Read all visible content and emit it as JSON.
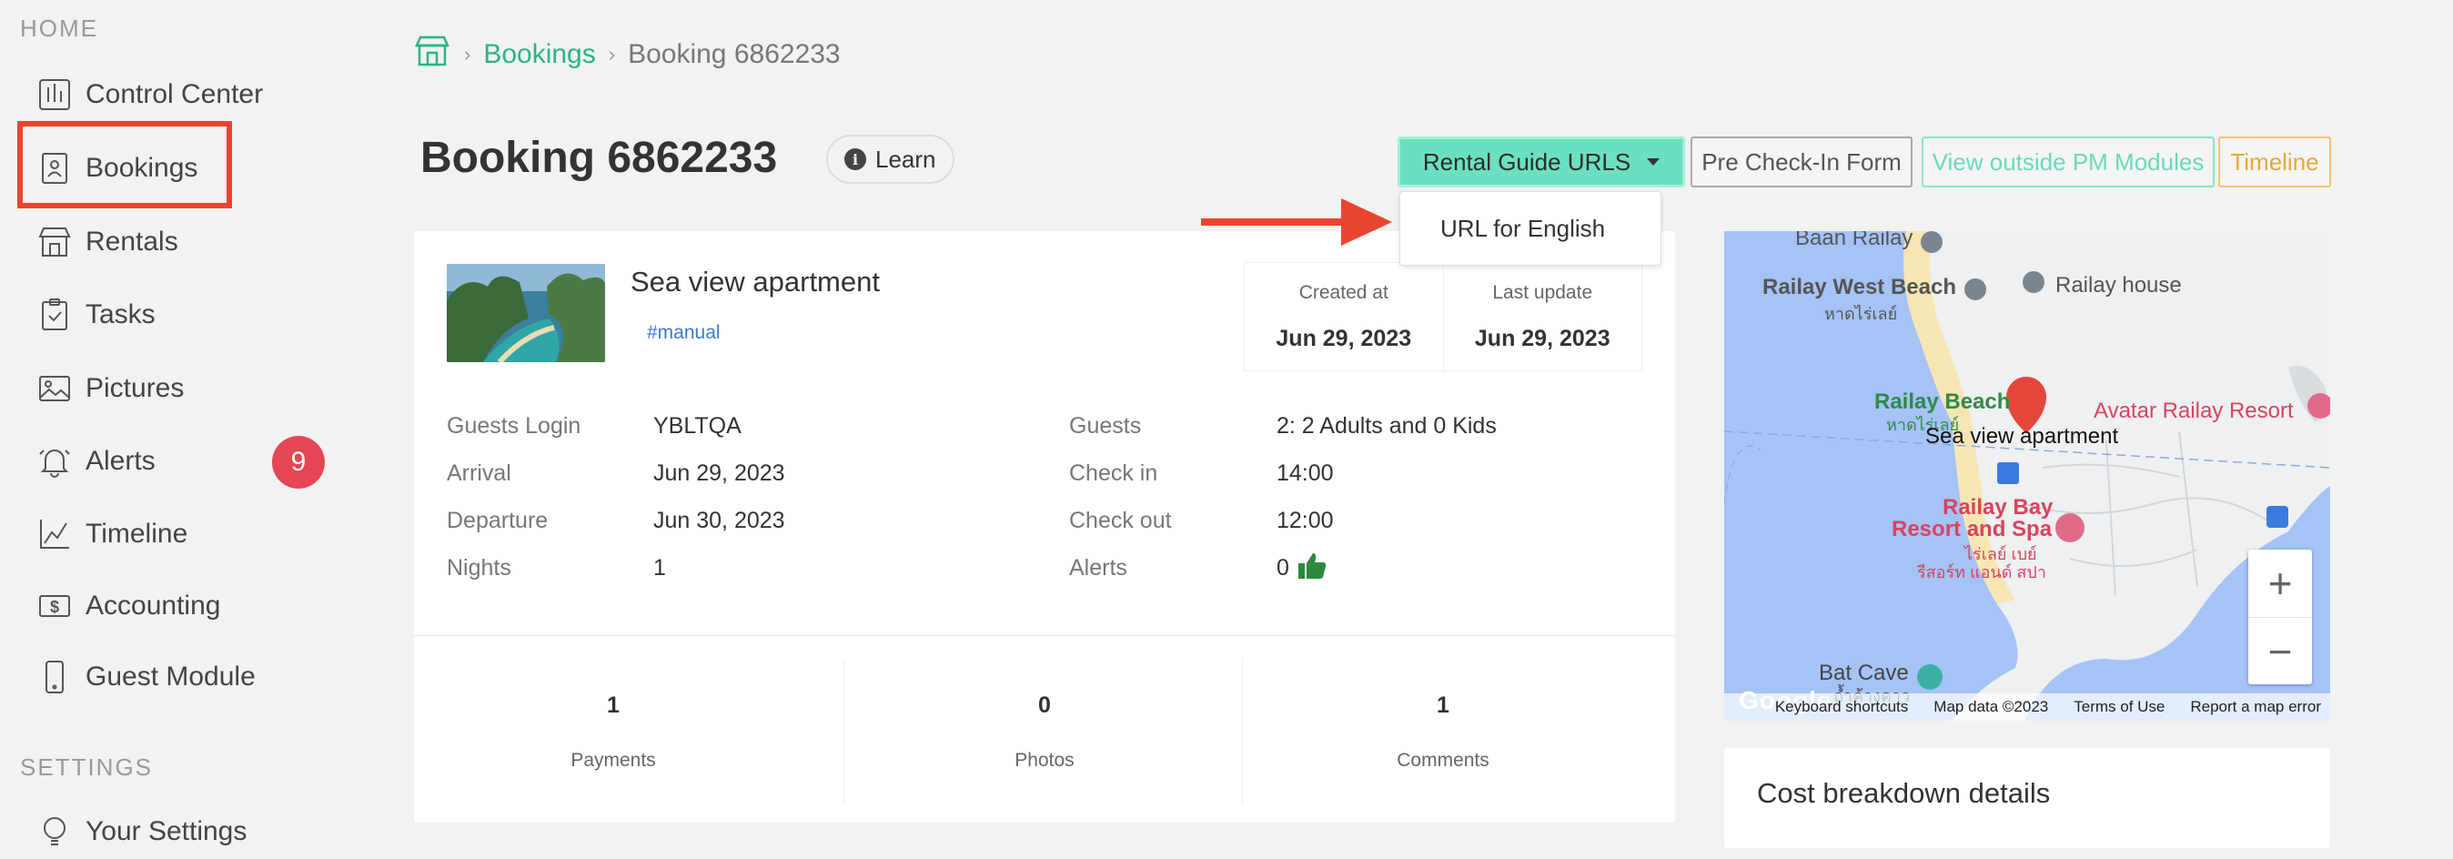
{
  "sidebar": {
    "home_title": "HOME",
    "settings_title": "SETTINGS",
    "items": [
      {
        "label": "Control Center"
      },
      {
        "label": "Bookings"
      },
      {
        "label": "Rentals"
      },
      {
        "label": "Tasks"
      },
      {
        "label": "Pictures"
      },
      {
        "label": "Alerts",
        "badge": "9"
      },
      {
        "label": "Timeline"
      },
      {
        "label": "Accounting"
      },
      {
        "label": "Guest Module"
      },
      {
        "label": "Your Settings"
      }
    ]
  },
  "breadcrumb": {
    "link": "Bookings",
    "current": "Booking 6862233"
  },
  "page": {
    "title": "Booking 6862233",
    "learn": "Learn"
  },
  "toolbar": {
    "rental_guide": "Rental Guide URLS",
    "precheck": "Pre Check-In Form",
    "outside": "View outside PM Modules",
    "timeline": "Timeline"
  },
  "dropdown": {
    "item": "URL for English"
  },
  "property": {
    "name": "Sea view apartment",
    "tag": "#manual"
  },
  "dates": {
    "created_label": "Created at",
    "created": "Jun 29, 2023",
    "updated_label": "Last update",
    "updated": "Jun 29, 2023"
  },
  "details": {
    "guests_login_label": "Guests Login",
    "guests_login": "YBLTQA",
    "arrival_label": "Arrival",
    "arrival": "Jun 29, 2023",
    "departure_label": "Departure",
    "departure": "Jun 30, 2023",
    "nights_label": "Nights",
    "nights": "1",
    "guests_label": "Guests",
    "guests": "2: 2 Adults and 0 Kids",
    "checkin_label": "Check in",
    "checkin": "14:00",
    "checkout_label": "Check out",
    "checkout": "12:00",
    "alerts_label": "Alerts",
    "alerts": "0"
  },
  "stats": [
    {
      "num": "1",
      "label": "Payments"
    },
    {
      "num": "0",
      "label": "Photos"
    },
    {
      "num": "1",
      "label": "Comments"
    }
  ],
  "map": {
    "labels": {
      "baan": "Baan Railay",
      "west": "Railay West Beach",
      "west_th": "หาดไร่เลย์",
      "house": "Railay house",
      "beach": "Railay Beach",
      "beach_th": "หาดไร่เลย์",
      "avatar": "Avatar Railay Resort",
      "pin": "Sea view apartment",
      "bay1": "Railay Bay",
      "bay2": "Resort and Spa",
      "bay_th1": "ไร่เลย์ เบย์",
      "bay_th2": "รีสอร์ท แอนด์ สปา",
      "cave": "Bat Cave",
      "cave_th": "ถ้ำค้างคาว",
      "google": "Google"
    },
    "footer": {
      "shortcuts": "Keyboard shortcuts",
      "data": "Map data ©2023",
      "terms": "Terms of Use",
      "report": "Report a map error"
    },
    "zoom_in": "+",
    "zoom_out": "−"
  },
  "cost": {
    "title": "Cost breakdown details"
  },
  "colors": {
    "accent": "#2bb38a",
    "highlight": "#e8452e",
    "badge": "#e64553"
  }
}
